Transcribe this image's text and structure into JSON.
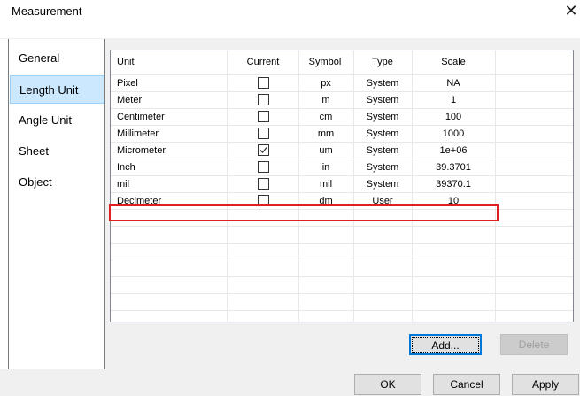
{
  "window": {
    "title": "Measurement",
    "close_glyph": "✕"
  },
  "sidebar": {
    "items": [
      {
        "label": "General",
        "selected": false
      },
      {
        "label": "Length Unit",
        "selected": true
      },
      {
        "label": "Angle Unit",
        "selected": false
      },
      {
        "label": "Sheet",
        "selected": false
      },
      {
        "label": "Object",
        "selected": false
      }
    ]
  },
  "table": {
    "columns": [
      "Unit",
      "Current",
      "Symbol",
      "Type",
      "Scale"
    ],
    "rows": [
      {
        "unit": "Pixel",
        "current": false,
        "symbol": "px",
        "type": "System",
        "scale": "NA"
      },
      {
        "unit": "Meter",
        "current": false,
        "symbol": "m",
        "type": "System",
        "scale": "1"
      },
      {
        "unit": "Centimeter",
        "current": false,
        "symbol": "cm",
        "type": "System",
        "scale": "100"
      },
      {
        "unit": "Millimeter",
        "current": false,
        "symbol": "mm",
        "type": "System",
        "scale": "1000"
      },
      {
        "unit": "Micrometer",
        "current": true,
        "symbol": "um",
        "type": "System",
        "scale": "1e+06"
      },
      {
        "unit": "Inch",
        "current": false,
        "symbol": "in",
        "type": "System",
        "scale": "39.3701"
      },
      {
        "unit": "mil",
        "current": false,
        "symbol": "mil",
        "type": "System",
        "scale": "39370.1"
      },
      {
        "unit": "Decimeter",
        "current": false,
        "symbol": "dm",
        "type": "User",
        "scale": "10"
      }
    ],
    "highlight_color": "#e02020"
  },
  "buttons": {
    "add": "Add...",
    "delete": "Delete",
    "ok": "OK",
    "cancel": "Cancel",
    "apply": "Apply"
  }
}
